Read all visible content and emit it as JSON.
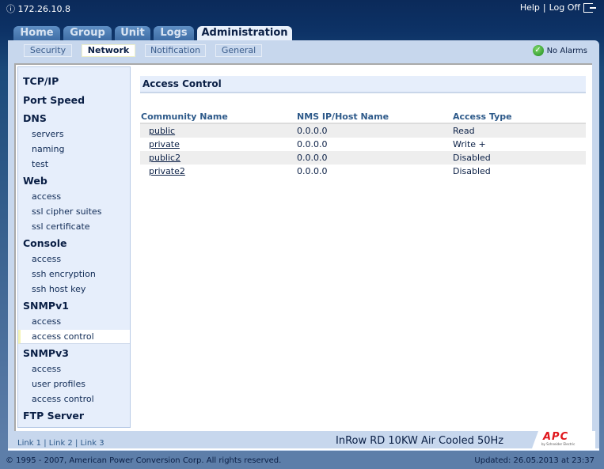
{
  "header": {
    "ip": "172.26.10.8",
    "help": "Help",
    "separator": "|",
    "logoff": "Log Off"
  },
  "tabs": [
    {
      "label": "Home"
    },
    {
      "label": "Group"
    },
    {
      "label": "Unit"
    },
    {
      "label": "Logs"
    },
    {
      "label": "Administration",
      "active": true
    }
  ],
  "subtabs": [
    {
      "label": "Security"
    },
    {
      "label": "Network",
      "active": true
    },
    {
      "label": "Notification"
    },
    {
      "label": "General"
    }
  ],
  "status": {
    "alarms": "No Alarms",
    "icon": "check-circle-icon",
    "color": "#1d8a1d"
  },
  "sidebar": [
    {
      "type": "h",
      "label": "TCP/IP"
    },
    {
      "type": "h",
      "label": "Port Speed"
    },
    {
      "type": "h",
      "label": "DNS"
    },
    {
      "type": "i",
      "label": "servers"
    },
    {
      "type": "i",
      "label": "naming"
    },
    {
      "type": "i",
      "label": "test"
    },
    {
      "type": "h",
      "label": "Web"
    },
    {
      "type": "i",
      "label": "access"
    },
    {
      "type": "i",
      "label": "ssl cipher suites"
    },
    {
      "type": "i",
      "label": "ssl certificate"
    },
    {
      "type": "h",
      "label": "Console"
    },
    {
      "type": "i",
      "label": "access"
    },
    {
      "type": "i",
      "label": "ssh encryption"
    },
    {
      "type": "i",
      "label": "ssh host key"
    },
    {
      "type": "h",
      "label": "SNMPv1"
    },
    {
      "type": "i",
      "label": "access"
    },
    {
      "type": "i",
      "label": "access control",
      "selected": true
    },
    {
      "type": "h",
      "label": "SNMPv3"
    },
    {
      "type": "i",
      "label": "access"
    },
    {
      "type": "i",
      "label": "user profiles"
    },
    {
      "type": "i",
      "label": "access control"
    },
    {
      "type": "h",
      "label": "FTP Server"
    }
  ],
  "main": {
    "title": "Access Control",
    "columns": [
      "Community Name",
      "NMS IP/Host Name",
      "Access Type"
    ],
    "rows": [
      [
        "public",
        "0.0.0.0",
        "Read"
      ],
      [
        "private",
        "0.0.0.0",
        "Write +"
      ],
      [
        "public2",
        "0.0.0.0",
        "Disabled"
      ],
      [
        "private2",
        "0.0.0.0",
        "Disabled"
      ]
    ]
  },
  "footer": {
    "links": [
      "Link 1",
      "Link 2",
      "Link 3"
    ],
    "model": "InRow RD 10KW Air Cooled 50Hz",
    "logo": "APC",
    "logo_sub": "by Schneider Electric",
    "copyright": "© 1995 - 2007, American Power Conversion Corp. All rights reserved.",
    "updated": "Updated: 26.05.2013 at 23:37"
  }
}
